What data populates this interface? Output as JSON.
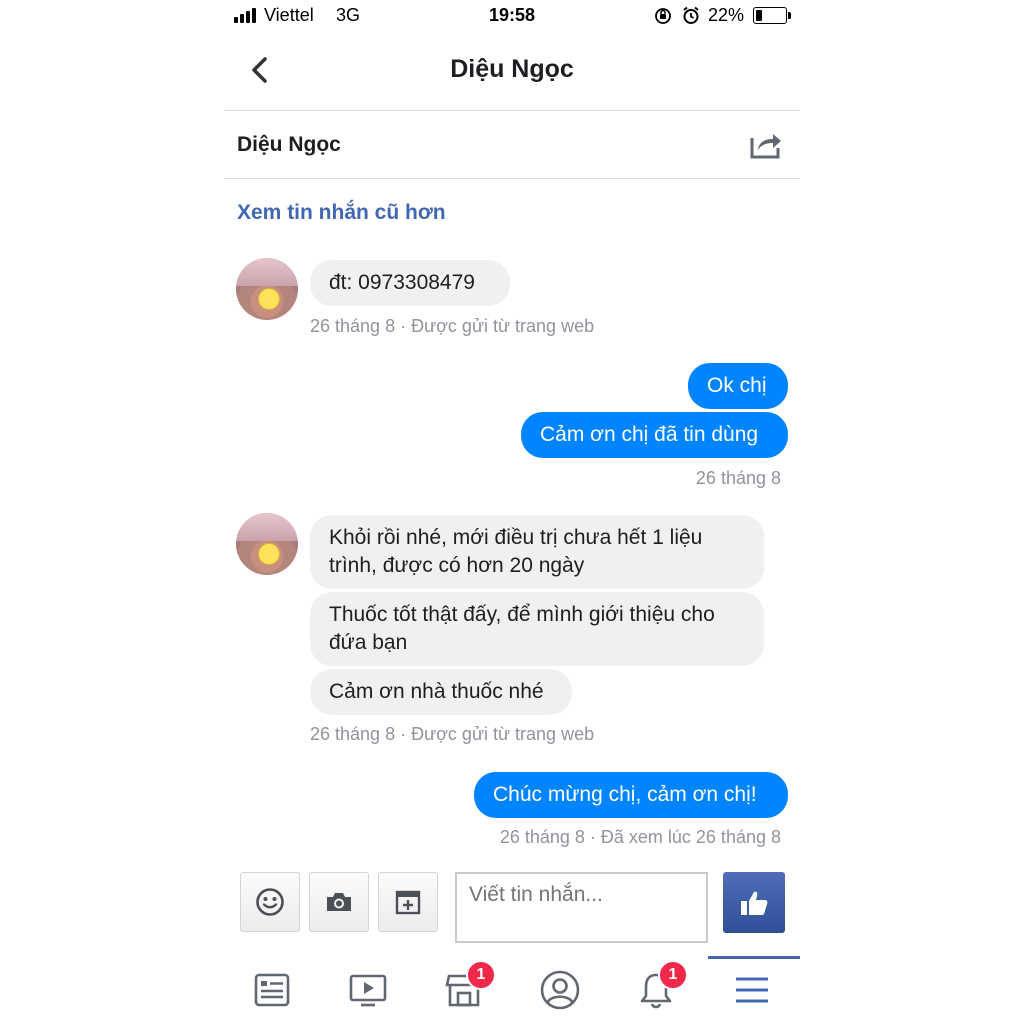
{
  "status_bar": {
    "carrier": "Viettel",
    "network": "3G",
    "time": "19:58",
    "battery": "22%"
  },
  "header": {
    "title": "Diệu Ngọc"
  },
  "contact": {
    "name": "Diệu Ngọc"
  },
  "older_messages_link": "Xem tin nhắn cũ hơn",
  "messages": {
    "g1_m1": "đt: 0973308479",
    "g1_meta": "26 tháng 8 · Được gửi từ trang web",
    "o1_m1": "Ok chị",
    "o1_m2": "Cảm ơn chị đã tin dùng",
    "o1_meta": "26 tháng 8",
    "g2_m1_l1": "Khỏi rồi nhé, mới điều trị chưa hết 1 liệu",
    "g2_m1_l2": "trình, được có hơn 20 ngày",
    "g2_m2_l1": "Thuốc tốt thật đấy, để mình giới thiệu cho",
    "g2_m2_l2": "đứa bạn",
    "g2_m3": "Cảm ơn nhà thuốc nhé",
    "g2_meta": "26 tháng 8 · Được gửi từ trang web",
    "o2_m1": "Chúc mừng chị, cảm ơn chị!",
    "o2_meta": "26 tháng 8 · Đã xem lúc 26 tháng 8"
  },
  "composer": {
    "placeholder": "Viết tin nhắn..."
  },
  "bottom_nav": {
    "items": [
      {
        "icon": "news-feed-icon"
      },
      {
        "icon": "watch-video-icon"
      },
      {
        "icon": "marketplace-icon",
        "badge": "1"
      },
      {
        "icon": "profile-icon"
      },
      {
        "icon": "notifications-bell-icon",
        "badge": "1"
      },
      {
        "icon": "menu-icon",
        "active": true
      }
    ]
  },
  "colors": {
    "accent": "#4267b2",
    "outgoing_bubble": "#0084ff",
    "incoming_bubble": "#f1f0f0",
    "badge": "#f02849"
  }
}
